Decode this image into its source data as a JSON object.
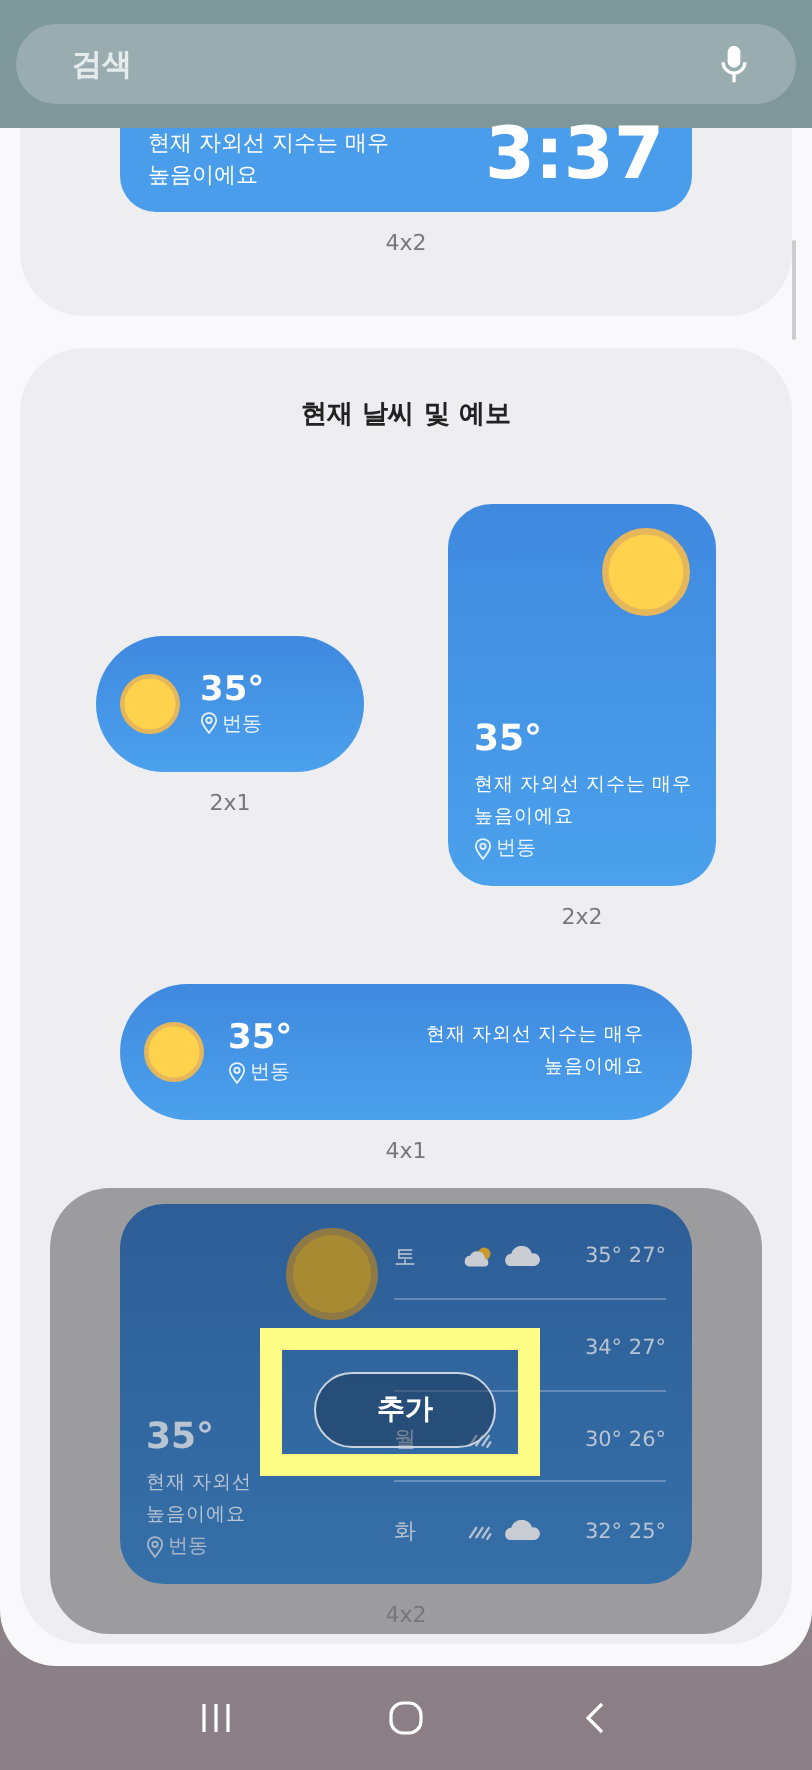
{
  "search": {
    "placeholder": "검색"
  },
  "top_widget": {
    "description_lines": [
      "현재 자외선 지수는 매우",
      "높음이에요"
    ],
    "time": "3:37",
    "size": "4x2"
  },
  "section": {
    "title": "현재 날씨 및 예보",
    "widgets": [
      {
        "kind": "pill_small",
        "selected": false,
        "temperature": "35°",
        "location": "번동",
        "size": "2x1"
      },
      {
        "kind": "square",
        "selected": false,
        "temperature": "35°",
        "description_lines": [
          "현재 자외선 지수는 매우",
          "높음이에요"
        ],
        "location": "번동",
        "size": "2x2"
      },
      {
        "kind": "pill_wide",
        "selected": false,
        "temperature": "35°",
        "location": "번동",
        "description_lines": [
          "현재 자외선 지수는 매우",
          "높음이에요"
        ],
        "size": "4x1"
      },
      {
        "kind": "large",
        "selected": true,
        "temperature": "35°",
        "description_lines": [
          "현재 자외선",
          "높음이에요"
        ],
        "location": "번동",
        "size": "4x2",
        "add_button": "추가",
        "forecast": [
          {
            "day": "토",
            "icons": [
              {
                "kind": "sun_cloud"
              },
              {
                "kind": "cloud"
              }
            ],
            "high": "35°",
            "low": "27°"
          },
          {
            "high": "34°",
            "low": "27°"
          },
          {
            "day": "월",
            "icons": [
              {
                "kind": "rain"
              }
            ],
            "high": "30°",
            "low": "26°"
          },
          {
            "day": "화",
            "icons": [
              {
                "kind": "rain"
              },
              {
                "kind": "cloud"
              }
            ],
            "high": "32°",
            "low": "25°"
          }
        ]
      }
    ]
  }
}
